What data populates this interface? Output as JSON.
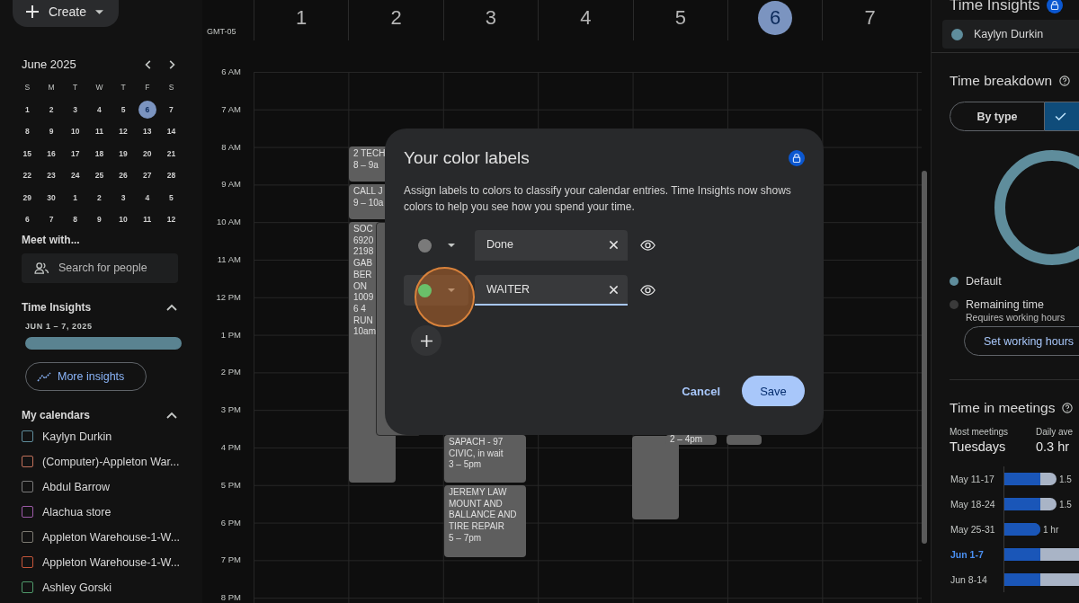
{
  "sidebar": {
    "create_button": "Create",
    "month": "June 2025",
    "weekdays": [
      "S",
      "M",
      "T",
      "W",
      "T",
      "F",
      "S"
    ],
    "weeks": [
      [
        {
          "d": "1",
          "selected": false
        },
        {
          "d": "2",
          "selected": false
        },
        {
          "d": "3",
          "selected": false
        },
        {
          "d": "4",
          "selected": false
        },
        {
          "d": "5",
          "selected": false
        },
        {
          "d": "6",
          "selected": true
        },
        {
          "d": "7",
          "selected": false
        }
      ],
      [
        {
          "d": "8",
          "selected": false
        },
        {
          "d": "9",
          "selected": false
        },
        {
          "d": "10",
          "selected": false
        },
        {
          "d": "11",
          "selected": false
        },
        {
          "d": "12",
          "selected": false
        },
        {
          "d": "13",
          "selected": false
        },
        {
          "d": "14",
          "selected": false
        }
      ],
      [
        {
          "d": "15",
          "selected": false
        },
        {
          "d": "16",
          "selected": false
        },
        {
          "d": "17",
          "selected": false
        },
        {
          "d": "18",
          "selected": false
        },
        {
          "d": "19",
          "selected": false
        },
        {
          "d": "20",
          "selected": false
        },
        {
          "d": "21",
          "selected": false
        }
      ],
      [
        {
          "d": "22",
          "selected": false
        },
        {
          "d": "23",
          "selected": false
        },
        {
          "d": "24",
          "selected": false
        },
        {
          "d": "25",
          "selected": false
        },
        {
          "d": "26",
          "selected": false
        },
        {
          "d": "27",
          "selected": false
        },
        {
          "d": "28",
          "selected": false
        }
      ],
      [
        {
          "d": "29",
          "selected": false
        },
        {
          "d": "30",
          "selected": false
        },
        {
          "d": "1",
          "selected": false
        },
        {
          "d": "2",
          "selected": false
        },
        {
          "d": "3",
          "selected": false
        },
        {
          "d": "4",
          "selected": false
        },
        {
          "d": "5",
          "selected": false
        }
      ],
      [
        {
          "d": "6",
          "selected": false
        },
        {
          "d": "7",
          "selected": false
        },
        {
          "d": "8",
          "selected": false
        },
        {
          "d": "9",
          "selected": false
        },
        {
          "d": "10",
          "selected": false
        },
        {
          "d": "11",
          "selected": false
        },
        {
          "d": "12",
          "selected": false
        }
      ]
    ],
    "meet_with": "Meet with...",
    "search": {
      "placeholder": "Search for people"
    },
    "time_insights": {
      "title": "Time Insights",
      "range": "JUN 1 – 7, 2025",
      "button": "More insights"
    },
    "calendars_title": "My calendars",
    "calendars": [
      {
        "name": "Kaylyn Durkin",
        "color": "#5f8d9c"
      },
      {
        "name": "(Computer)-Appleton War...",
        "color": "#c0705a"
      },
      {
        "name": "Abdul Barrow",
        "color": "#7a7a7a"
      },
      {
        "name": "Alachua store",
        "color": "#9c5aa8"
      },
      {
        "name": "Appleton Warehouse-1-W...",
        "color": "#7d7a72"
      },
      {
        "name": "Appleton Warehouse-1-W...",
        "color": "#c4553a"
      },
      {
        "name": "Ashley Gorski",
        "color": "#4f9a6b"
      }
    ]
  },
  "calendar": {
    "timezone": "GMT-05",
    "days": [
      {
        "label": "1",
        "selected": false
      },
      {
        "label": "2",
        "selected": false
      },
      {
        "label": "3",
        "selected": false
      },
      {
        "label": "4",
        "selected": false
      },
      {
        "label": "5",
        "selected": false
      },
      {
        "label": "6",
        "selected": true
      },
      {
        "label": "7",
        "selected": false
      }
    ],
    "hours": [
      "6 AM",
      "7 AM",
      "8 AM",
      "9 AM",
      "10 AM",
      "11 AM",
      "12 PM",
      "1 PM",
      "2 PM",
      "3 PM",
      "4 PM",
      "5 PM",
      "6 PM",
      "7 PM",
      "8 PM"
    ],
    "events": [
      {
        "kind": "text",
        "lines": [
          "2 TECH",
          "8 – 9a"
        ]
      },
      {
        "kind": "text",
        "lines": [
          "CALL J",
          "9 – 10a"
        ]
      },
      {
        "kind": "text",
        "lines": [
          "SOC",
          "6920",
          "2198",
          "GAB",
          "BER",
          "ON",
          "1009",
          "6 4",
          "RUN",
          "10am"
        ]
      },
      {
        "kind": "blank"
      },
      {
        "kind": "text",
        "lines": [
          "SAPACH - 97",
          "CIVIC, in wait",
          "3 – 5pm"
        ]
      },
      {
        "kind": "text",
        "lines": [
          "JEREMY LAW MOUNT AND BALLANCE AND TIRE REPAIR",
          "5 – 7pm"
        ]
      },
      {
        "kind": "blank"
      },
      {
        "kind": "text",
        "lines": [
          "2 – 4pm"
        ]
      },
      {
        "kind": "blank"
      }
    ]
  },
  "dialog": {
    "title": "Your color labels",
    "description": "Assign labels to colors to classify your calendar entries. Time Insights now shows colors to help you see how you spend your time.",
    "labels": [
      {
        "color": "#7a7a7a",
        "value": "Done",
        "focused": false
      },
      {
        "color": "#6abf69",
        "value": "WAITER",
        "focused": true
      }
    ],
    "cancel": "Cancel",
    "save": "Save"
  },
  "insights_panel": {
    "title": "Time Insights",
    "person": {
      "name": "Kaylyn Durkin",
      "color": "#5f8d9c"
    },
    "breakdown_title": "Time breakdown",
    "segments": [
      {
        "label": "By type",
        "selected": false
      },
      {
        "selected": true
      }
    ],
    "legend": [
      {
        "label": "Default",
        "color": "#5f8d9c"
      },
      {
        "label": "Remaining time",
        "note": "Requires working hours",
        "color": "#3a3a3a"
      }
    ],
    "working_hours_button": "Set working hours",
    "meetings_title": "Time in meetings",
    "stats": [
      {
        "label": "Most meetings",
        "value": "Tuesdays"
      },
      {
        "label": "Daily ave",
        "value": "0.3 hr"
      }
    ],
    "weeks": [
      {
        "label": "May 11-17",
        "kind": "stacked",
        "reading": "1.5",
        "selected": false
      },
      {
        "label": "May 18-24",
        "kind": "stacked",
        "reading": "1.5",
        "selected": false
      },
      {
        "label": "May 25-31",
        "kind": "single",
        "reading": "1 hr",
        "selected": false
      },
      {
        "label": "Jun 1-7",
        "kind": "stacked",
        "selected": true
      },
      {
        "label": "Jun 8-14",
        "kind": "stacked",
        "selected": false
      }
    ]
  }
}
